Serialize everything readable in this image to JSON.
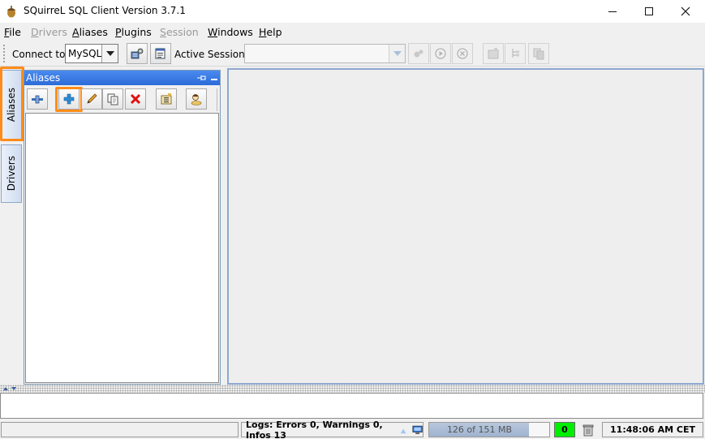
{
  "window": {
    "title": "SQuirreL SQL Client Version 3.7.1"
  },
  "menu": [
    {
      "label": "File",
      "underline": "F",
      "rest": "ile",
      "disabled": false
    },
    {
      "label": "Drivers",
      "underline": "D",
      "rest": "rivers",
      "disabled": true
    },
    {
      "label": "Aliases",
      "underline": "A",
      "rest": "liases",
      "disabled": false
    },
    {
      "label": "Plugins",
      "underline": "P",
      "rest": "lugins",
      "disabled": false
    },
    {
      "label": "Session",
      "underline": "S",
      "rest": "ession",
      "disabled": true
    },
    {
      "label": "Windows",
      "underline": "W",
      "rest": "indows",
      "disabled": false
    },
    {
      "label": "Help",
      "underline": "H",
      "rest": "elp",
      "disabled": false
    }
  ],
  "toolbar": {
    "connect_label": "Connect to:",
    "connect_value": "MySQL",
    "active_session_label": "Active Session:",
    "active_session_value": ""
  },
  "left_tabs": {
    "aliases": "Aliases",
    "drivers": "Drivers"
  },
  "aliases_panel": {
    "title": "Aliases"
  },
  "statusbar": {
    "logs": "Logs: Errors 0, Warnings 0, Infos 13",
    "memory": "126 of 151 MB",
    "memory_used_fraction": 0.83,
    "counter": "0",
    "time": "11:48:06 AM CET"
  },
  "colors": {
    "highlight": "#ff8c1a",
    "header_blue": "#2c6bd8",
    "status_green": "#00ee00"
  }
}
